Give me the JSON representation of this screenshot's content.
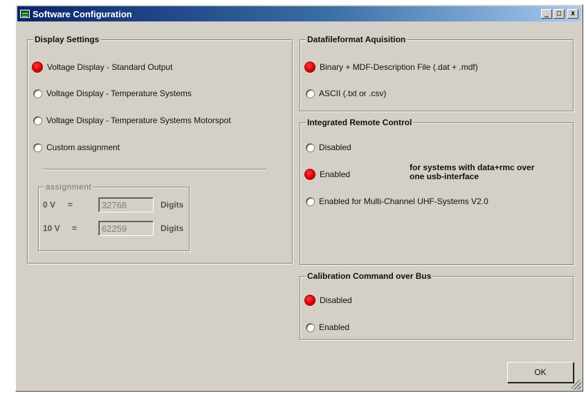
{
  "window": {
    "title": "Software Configuration",
    "min_label": "_",
    "max_label": "□",
    "close_label": "x"
  },
  "display_settings": {
    "title": "Display Settings",
    "options": [
      {
        "label": "Voltage Display - Standard Output",
        "selected": true
      },
      {
        "label": "Voltage Display - Temperature Systems",
        "selected": false
      },
      {
        "label": "Voltage Display - Temperature Systems Motorspot",
        "selected": false
      },
      {
        "label": "Custom assignment",
        "selected": false
      }
    ],
    "assignment": {
      "title": "assignment",
      "rows": [
        {
          "label": "0 V",
          "eq": "=",
          "value": "32768",
          "unit": "Digits"
        },
        {
          "label": "10 V",
          "eq": "=",
          "value": "62259",
          "unit": "Digits"
        }
      ]
    }
  },
  "datafile": {
    "title": "Datafileformat Aquisition",
    "options": [
      {
        "label": "Binary + MDF-Description File (.dat + .mdf)",
        "selected": true
      },
      {
        "label": "ASCII (.txt or .csv)",
        "selected": false
      }
    ]
  },
  "remote": {
    "title": "Integrated Remote Control",
    "options": [
      {
        "label": "Disabled",
        "selected": false
      },
      {
        "label": "Enabled",
        "selected": true
      },
      {
        "label": "Enabled for Multi-Channel UHF-Systems V2.0",
        "selected": false
      }
    ],
    "note_line1": "for systems with data+rmc over",
    "note_line2": "one usb-interface"
  },
  "calibration": {
    "title": "Calibration Command over Bus",
    "options": [
      {
        "label": "Disabled",
        "selected": true
      },
      {
        "label": "Enabled",
        "selected": false
      }
    ]
  },
  "ok_label": "OK",
  "colors": {
    "selected_radio": "#e00000",
    "titlebar": "#0a246a",
    "face": "#d4d0c8"
  }
}
